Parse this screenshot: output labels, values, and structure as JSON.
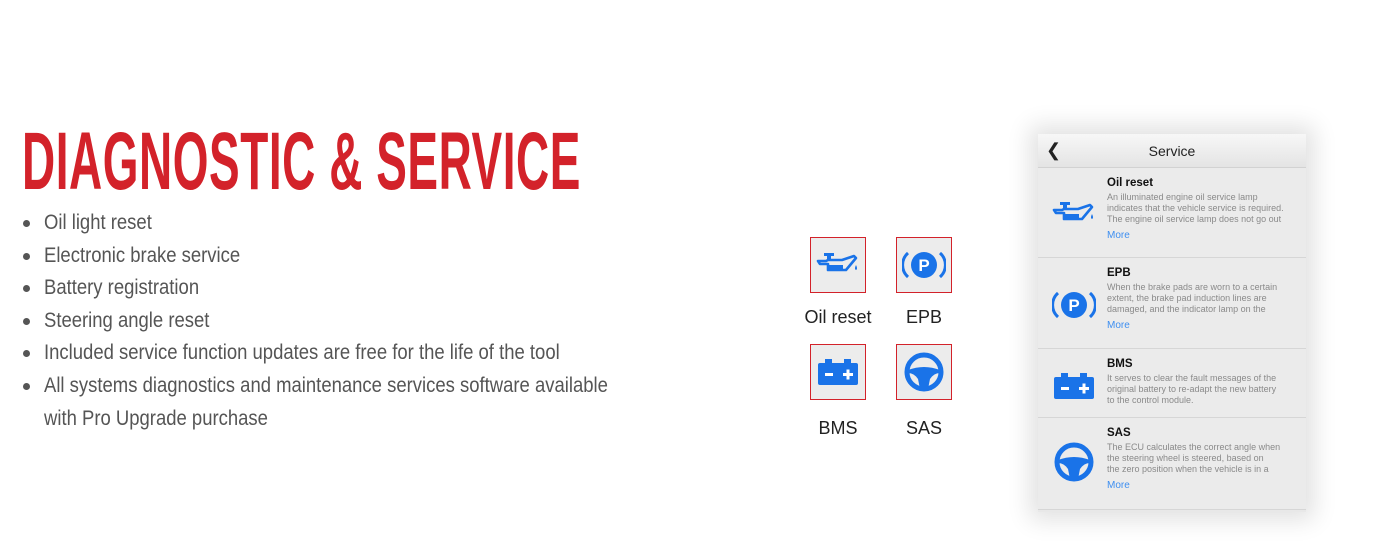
{
  "headline": "DIAGNOSTIC & SERVICE",
  "features": [
    "Oil light reset",
    "Electronic brake service",
    "Battery registration",
    "Steering angle reset",
    "Included service function updates are free for the life of the tool",
    "All systems diagnostics and maintenance services software available",
    "with Pro Upgrade purchase"
  ],
  "tiles": [
    {
      "label": "Oil reset",
      "icon": "oil-can-icon"
    },
    {
      "label": "EPB",
      "icon": "parking-brake-icon"
    },
    {
      "label": "BMS",
      "icon": "battery-icon"
    },
    {
      "label": "SAS",
      "icon": "steering-wheel-icon"
    }
  ],
  "phone": {
    "title": "Service",
    "back_icon": "chevron-left-icon",
    "items": [
      {
        "name": "Oil reset",
        "icon": "oil-can-icon",
        "desc": [
          "An illuminated engine oil service lamp",
          "indicates that the vehicle service is required.",
          "The engine oil service lamp does not go out"
        ],
        "more": "More"
      },
      {
        "name": "EPB",
        "icon": "parking-brake-icon",
        "desc": [
          "When the brake pads are worn to a certain",
          "extent, the brake pad induction lines are",
          "damaged, and the indicator lamp on the"
        ],
        "more": "More"
      },
      {
        "name": "BMS",
        "icon": "battery-icon",
        "desc": [
          "It serves to clear the fault messages of the",
          "original battery to re-adapt the new battery",
          "to the control module."
        ],
        "more": ""
      },
      {
        "name": "SAS",
        "icon": "steering-wheel-icon",
        "desc": [
          "The ECU calculates the correct angle when",
          "the steering wheel is steered, based on",
          "the zero position when the vehicle is in a"
        ],
        "more": "More"
      }
    ]
  },
  "colors": {
    "accent_red": "#d3222a",
    "icon_blue": "#1a73e8",
    "link_blue": "#3d8ef0",
    "body_text": "#555555"
  }
}
